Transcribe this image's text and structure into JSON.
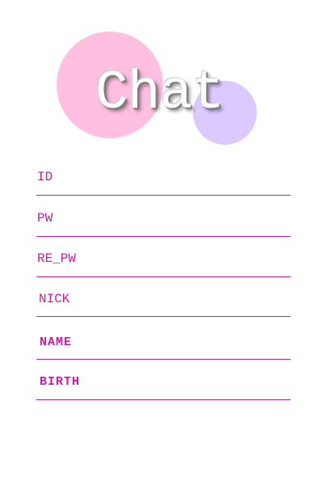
{
  "app": {
    "title": "Chat"
  },
  "colors": {
    "accent": "#c21ea0",
    "circle_pink": "#ffbfe1",
    "circle_purple": "#dcc9ff",
    "background": "#ffffff"
  },
  "form": {
    "fields": [
      {
        "label": "ID",
        "value": ""
      },
      {
        "label": "PW",
        "value": ""
      },
      {
        "label": "RE_PW",
        "value": ""
      },
      {
        "label": "NICK",
        "value": ""
      },
      {
        "label": "NAME",
        "value": ""
      },
      {
        "label": "BIRTH",
        "value": ""
      }
    ]
  }
}
